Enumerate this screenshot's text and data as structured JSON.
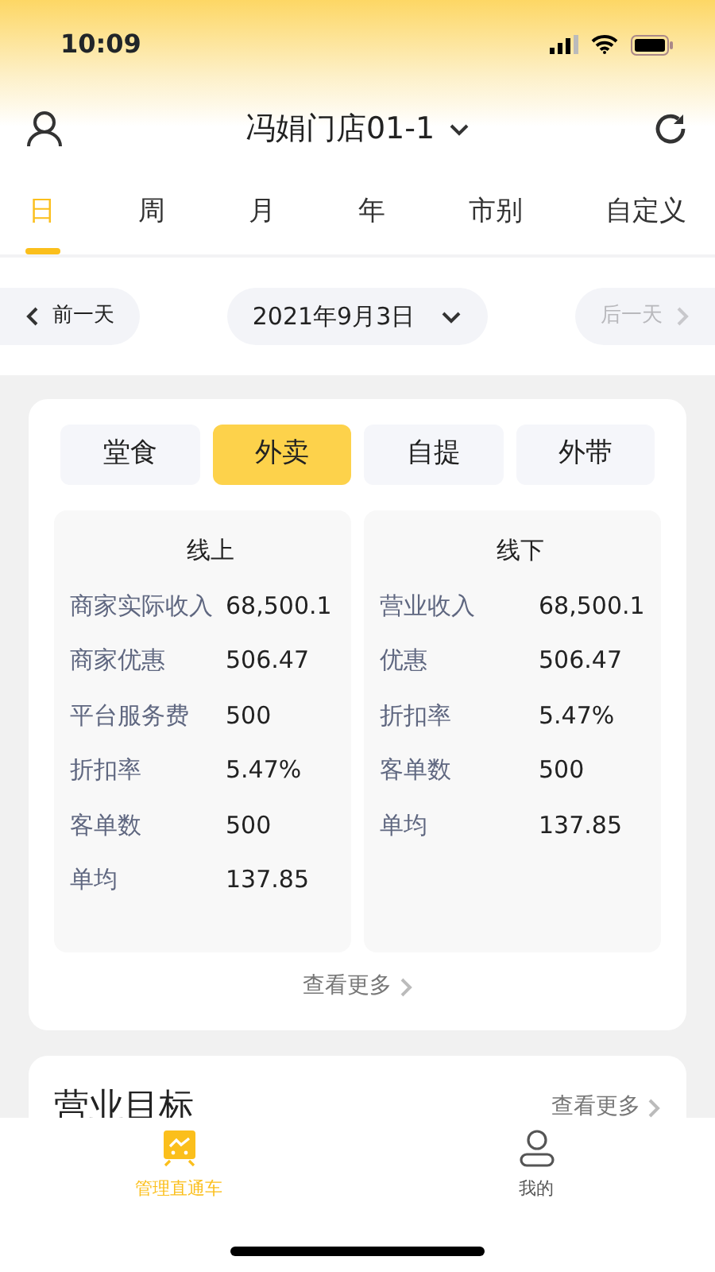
{
  "status_bar": {
    "time": "10:09"
  },
  "header": {
    "store": "冯娟门店01-1"
  },
  "tabs": [
    {
      "label": "日",
      "selected": true
    },
    {
      "label": "周",
      "selected": false
    },
    {
      "label": "月",
      "selected": false
    },
    {
      "label": "年",
      "selected": false
    },
    {
      "label": "市别",
      "selected": false
    },
    {
      "label": "自定义",
      "selected": false
    }
  ],
  "date_nav": {
    "prev": {
      "label": "前一天",
      "disabled": false
    },
    "date": "2021年9月3日",
    "next": {
      "label": "后一天",
      "disabled": true
    }
  },
  "channels": [
    {
      "label": "堂食",
      "selected": false
    },
    {
      "label": "外卖",
      "selected": true
    },
    {
      "label": "自提",
      "selected": false
    },
    {
      "label": "外带",
      "selected": false
    }
  ],
  "panels": [
    {
      "title": "线上",
      "rows": [
        {
          "label": "商家实际收入",
          "value": "68,500.1"
        },
        {
          "label": "商家优惠",
          "value": "506.47"
        },
        {
          "label": "平台服务费",
          "value": "500"
        },
        {
          "label": "折扣率",
          "value": "5.47%"
        },
        {
          "label": "客单数",
          "value": "500"
        },
        {
          "label": "单均",
          "value": "137.85"
        }
      ]
    },
    {
      "title": "线下",
      "rows": [
        {
          "label": "营业收入",
          "value": "68,500.1"
        },
        {
          "label": "优惠",
          "value": "506.47"
        },
        {
          "label": "折扣率",
          "value": "5.47%"
        },
        {
          "label": "客单数",
          "value": "500"
        },
        {
          "label": "单均",
          "value": "137.85"
        }
      ]
    }
  ],
  "more": "查看更多",
  "target_card": {
    "title": "营业目标",
    "more": "查看更多"
  },
  "bottom_nav": [
    {
      "label": "管理直通车",
      "selected": true
    },
    {
      "label": "我的",
      "selected": false
    }
  ]
}
